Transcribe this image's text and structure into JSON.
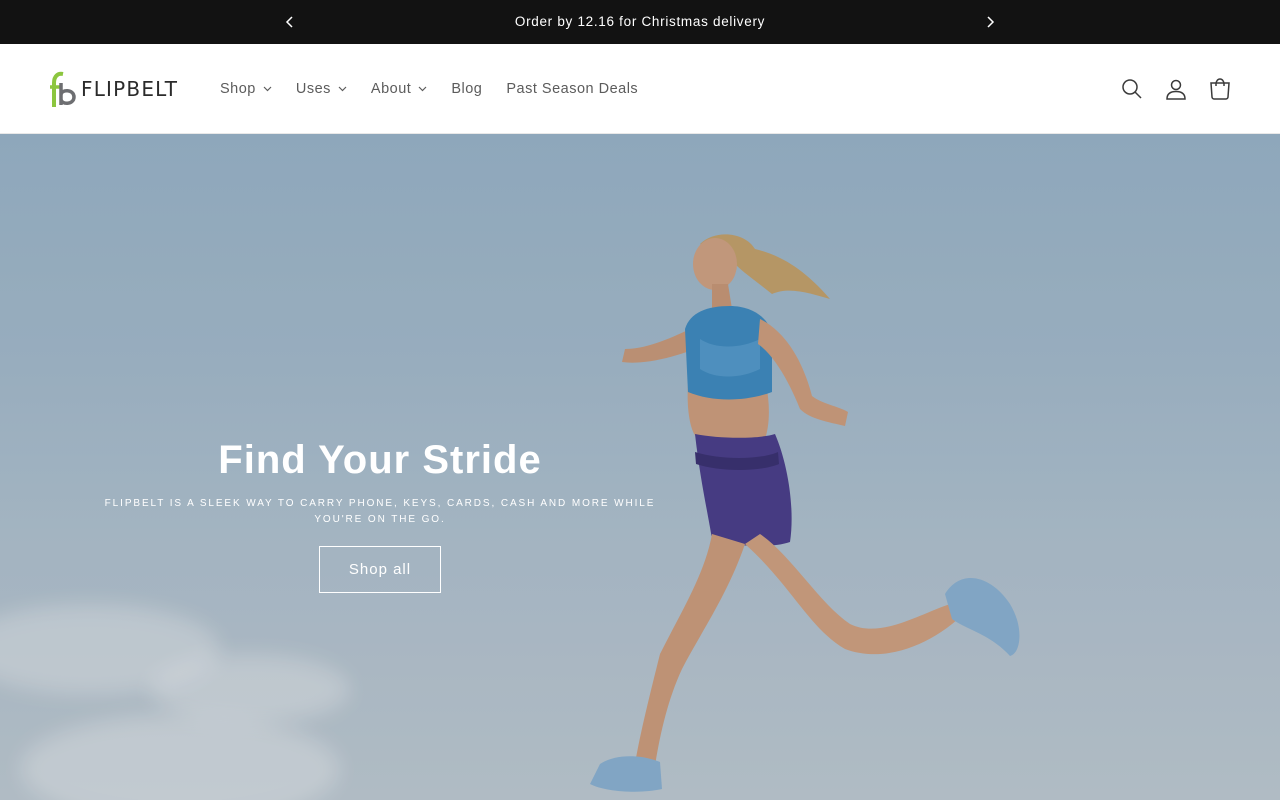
{
  "announcement": {
    "text": "Order by 12.16 for Christmas delivery",
    "prev_icon": "chevron-left-icon",
    "next_icon": "chevron-right-icon"
  },
  "header": {
    "logo_text": "FLIPBELT",
    "logo_colors": {
      "leaf": "#8cc63f",
      "mark": "#6d6e71"
    },
    "nav": [
      {
        "label": "Shop",
        "has_dropdown": true
      },
      {
        "label": "Uses",
        "has_dropdown": true
      },
      {
        "label": "About",
        "has_dropdown": true
      },
      {
        "label": "Blog",
        "has_dropdown": false
      },
      {
        "label": "Past Season Deals",
        "has_dropdown": false
      }
    ],
    "icons": [
      "search-icon",
      "account-icon",
      "cart-icon"
    ]
  },
  "hero": {
    "title": "Find Your Stride",
    "subtitle": "FLIPBELT IS A SLEEK WAY TO CARRY PHONE, KEYS, CARDS, CASH AND MORE WHILE YOU'RE ON THE GO.",
    "button_label": "Shop all"
  },
  "colors": {
    "announcement_bg": "#121212",
    "sky": "#a8bfd1",
    "nav_text": "#5c5c5c"
  }
}
